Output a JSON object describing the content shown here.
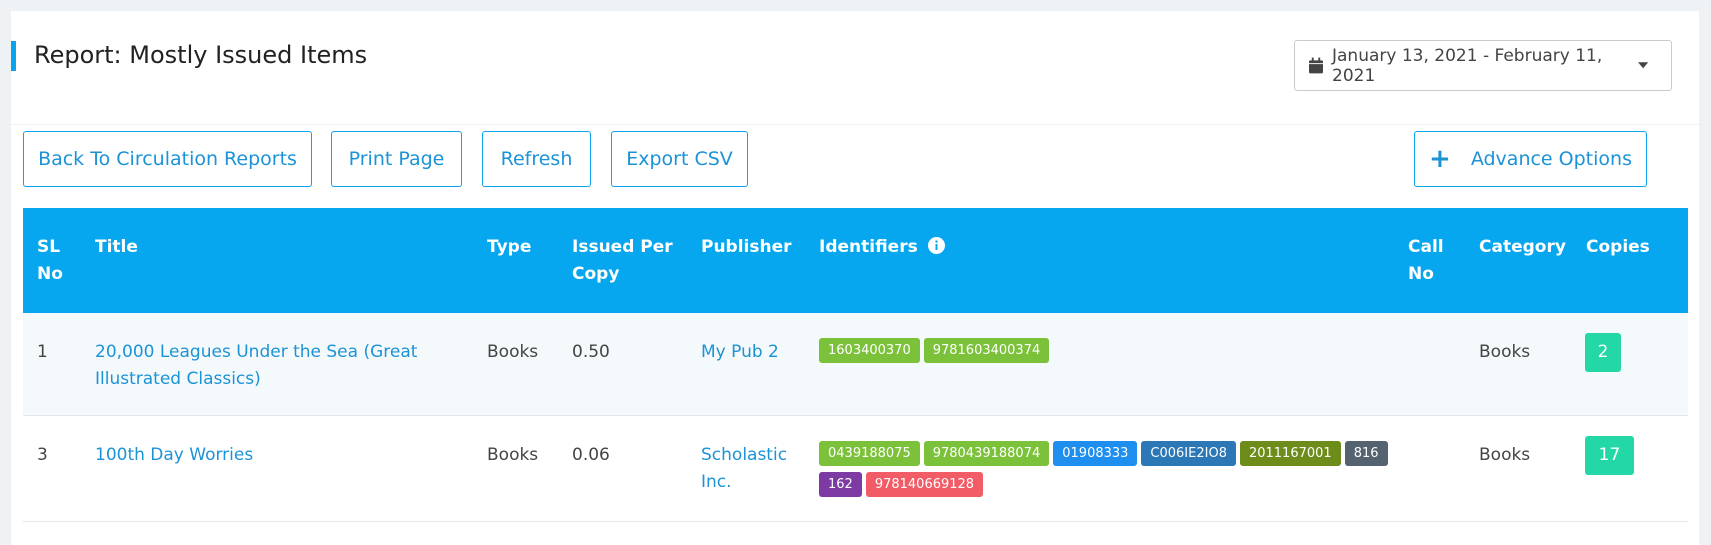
{
  "page": {
    "title": "Report: Mostly Issued Items",
    "date_range": "January 13, 2021 - February 11, 2021",
    "accent_color": "#0aa4ec"
  },
  "toolbar": {
    "back_label": "Back To Circulation Reports",
    "print_label": "Print Page",
    "refresh_label": "Refresh",
    "export_label": "Export CSV",
    "advance_label": "Advance Options"
  },
  "table": {
    "header_color": "#06a7ef",
    "columns": {
      "sl": "SL No",
      "title": "Title",
      "type": "Type",
      "issued": "Issued Per Copy",
      "publisher": "Publisher",
      "identifiers": "Identifiers",
      "call": "Call No",
      "category": "Category",
      "copies": "Copies"
    },
    "rows": [
      {
        "sl": "1",
        "title": "20,000 Leagues Under the Sea (Great Illustrated Classics)",
        "type": "Books",
        "issued": "0.50",
        "publisher": "My Pub 2",
        "identifiers": [
          {
            "text": "1603400370",
            "color": "#7cc13a"
          },
          {
            "text": "9781603400374",
            "color": "#7cc13a"
          }
        ],
        "call": "",
        "category": "Books",
        "copies": "2"
      },
      {
        "sl": "3",
        "title": "100th Day Worries",
        "type": "Books",
        "issued": "0.06",
        "publisher": "Scholastic Inc.",
        "identifiers": [
          {
            "text": "0439188075",
            "color": "#7cc13a"
          },
          {
            "text": "9780439188074",
            "color": "#7cc13a"
          },
          {
            "text": "01908333",
            "color": "#1e8fef"
          },
          {
            "text": "C006IE2IO8",
            "color": "#2c77b5"
          },
          {
            "text": "2011167001",
            "color": "#6d8c1a"
          },
          {
            "text": "816",
            "color": "#556370"
          },
          {
            "text": "162",
            "color": "#7d3aa3"
          },
          {
            "text": "978140669128",
            "color": "#f25c66"
          }
        ],
        "call": "",
        "category": "Books",
        "copies": "17"
      }
    ]
  }
}
